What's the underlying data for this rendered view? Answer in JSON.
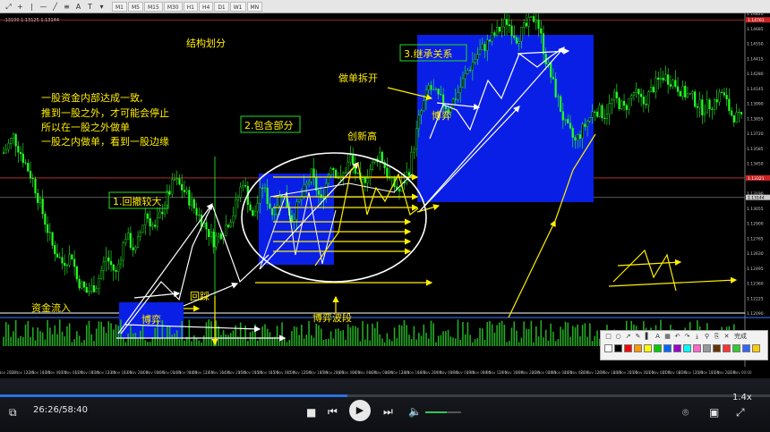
{
  "toolbar": {
    "timeframes": [
      "M1",
      "M5",
      "M15",
      "M30",
      "H1",
      "H4",
      "D1",
      "W1",
      "MN"
    ],
    "icons": [
      "cursor-icon",
      "crosshair-icon",
      "vertical-line-icon",
      "horizontal-line-icon",
      "trendline-icon",
      "pitchfork-icon",
      "text-icon",
      "label-icon",
      "dropdown-icon"
    ]
  },
  "colors": {
    "background": "#000000",
    "bull_candle": "#22ff22",
    "bear_candle": "#22ff22",
    "box_fill": "#0a1fe6",
    "white_arrow": "#ffffff",
    "yellow_arrow": "#ffee00",
    "annotation_text": "#ffee00",
    "box_label_border": "#22dd22",
    "level_line": "#cc3333",
    "volume_bar": "#22aa22"
  },
  "header": {
    "symbol_quote": ".13190 1.13125 1.13144"
  },
  "annotations": {
    "title_structure": "结构划分",
    "para_line1": "一股资金内部达成一致,",
    "para_line2": "推到一股之外，才可能会停止",
    "para_line3": "所以在一股之外做单",
    "para_line4": "一股之内做单，看到一股边缘",
    "label1": "1.回撤较大",
    "label2": "2.包含部分",
    "label3": "3.继承关系",
    "inflow": "资金流入",
    "game1": "博弈",
    "pullback": "回踩",
    "game_wave": "博弈波段",
    "new_high": "创新高",
    "split_order": "做单拆开",
    "game2": "博弈"
  },
  "chart_data": {
    "type": "candlestick",
    "symbol_quote": ".13190 1.13125 1.13144",
    "ylim": [
      1.1209,
      1.1482
    ],
    "y_ticks": [
      "1.14820",
      "1.14685",
      "1.14550",
      "1.14415",
      "1.14280",
      "1.14145",
      "1.13990",
      "1.13855",
      "1.13720",
      "1.13585",
      "1.13450",
      "1.13325",
      "1.13190",
      "1.13055",
      "1.12900",
      "1.12765",
      "1.12630",
      "1.12495",
      "1.12360",
      "1.12225",
      "1.12090"
    ],
    "highlighted_levels": [
      "1.14761",
      "1.13321",
      "1.13144"
    ],
    "x_ticks": [
      "9 Nov 2018",
      "12 Nov 12:00",
      "12 Nov 16:00",
      "13 Nov 00:00",
      "13 Nov 04:00",
      "13 Nov 08:00",
      "13 Nov 12:00",
      "13 Nov 16:00",
      "13 Nov 20:00",
      "14 Nov 00:00",
      "14 Nov 04:00",
      "14 Nov 08:00",
      "14 Nov 12:00",
      "14 Nov 16:00",
      "14 Nov 20:00",
      "15 Nov 00:00",
      "15 Nov 04:00",
      "15 Nov 08:00",
      "15 Nov 12:00",
      "15 Nov 16:00",
      "15 Nov 20:00",
      "16 Nov 00:00",
      "16 Nov 04:00",
      "16 Nov 08:00",
      "16 Nov 12:00",
      "16 Nov 16:00",
      "16 Nov 20:00",
      "19 Nov 00:00",
      "19 Nov 04:00",
      "19 Nov 08:00",
      "19 Nov 12:00",
      "19 Nov 16:00",
      "19 Nov 20:00",
      "20 Nov 00:00",
      "20 Nov 04:00",
      "20 Nov 08:00",
      "20 Nov 12:00",
      "20 Nov 16:00",
      "20 Nov 20:00",
      "21 Nov 00:00",
      "21 Nov 04:00",
      "21 Nov 08:00",
      "21 Nov 12:00",
      "21 Nov 16:00",
      "21 Nov 20:00",
      "22 Nov 00:00"
    ],
    "close_path": [
      [
        0,
        1.1355
      ],
      [
        4,
        1.137
      ],
      [
        8,
        1.135
      ],
      [
        12,
        1.133
      ],
      [
        16,
        1.13
      ],
      [
        20,
        1.127
      ],
      [
        24,
        1.1255
      ],
      [
        28,
        1.1262
      ],
      [
        30,
        1.124
      ],
      [
        34,
        1.1228
      ],
      [
        38,
        1.1235
      ],
      [
        42,
        1.126
      ],
      [
        46,
        1.1245
      ],
      [
        50,
        1.128
      ],
      [
        54,
        1.1265
      ],
      [
        58,
        1.13
      ],
      [
        62,
        1.1285
      ],
      [
        66,
        1.131
      ],
      [
        70,
        1.133
      ],
      [
        74,
        1.132
      ],
      [
        78,
        1.1305
      ],
      [
        82,
        1.129
      ],
      [
        86,
        1.1275
      ],
      [
        90,
        1.1285
      ],
      [
        94,
        1.13
      ],
      [
        98,
        1.133
      ],
      [
        102,
        1.1295
      ],
      [
        106,
        1.1325
      ],
      [
        110,
        1.13
      ],
      [
        114,
        1.132
      ],
      [
        118,
        1.1295
      ],
      [
        122,
        1.1315
      ],
      [
        126,
        1.1335
      ],
      [
        130,
        1.131
      ],
      [
        134,
        1.1345
      ],
      [
        138,
        1.133
      ],
      [
        142,
        1.135
      ],
      [
        146,
        1.1325
      ],
      [
        150,
        1.134
      ],
      [
        154,
        1.1355
      ],
      [
        158,
        1.133
      ],
      [
        162,
        1.132
      ],
      [
        166,
        1.134
      ],
      [
        170,
        1.1385
      ],
      [
        174,
        1.1415
      ],
      [
        178,
        1.1405
      ],
      [
        182,
        1.1395
      ],
      [
        186,
        1.141
      ],
      [
        190,
        1.143
      ],
      [
        194,
        1.1445
      ],
      [
        198,
        1.1455
      ],
      [
        202,
        1.1465
      ],
      [
        206,
        1.1475
      ],
      [
        210,
        1.146
      ],
      [
        214,
        1.147
      ],
      [
        218,
        1.148
      ],
      [
        222,
        1.144
      ],
      [
        226,
        1.141
      ],
      [
        230,
        1.138
      ],
      [
        234,
        1.1365
      ],
      [
        238,
        1.138
      ],
      [
        242,
        1.1395
      ],
      [
        246,
        1.139
      ],
      [
        250,
        1.1405
      ],
      [
        254,
        1.1395
      ],
      [
        258,
        1.141
      ],
      [
        262,
        1.14
      ],
      [
        266,
        1.1415
      ],
      [
        270,
        1.1425
      ],
      [
        274,
        1.142
      ],
      [
        278,
        1.141
      ],
      [
        282,
        1.1405
      ],
      [
        286,
        1.1395
      ],
      [
        290,
        1.14
      ],
      [
        294,
        1.141
      ],
      [
        298,
        1.139
      ],
      [
        302,
        1.1385
      ]
    ]
  },
  "player": {
    "time": "26:26/58:40",
    "progress": 0.4506,
    "volume": 0.6,
    "speed": "1.4x",
    "controls": [
      "subtitle-icon",
      "stop-icon",
      "prev-icon",
      "play-icon",
      "next-icon",
      "volume-icon",
      "camera-icon",
      "fullscreen-icon"
    ]
  },
  "annotation_toolbar": {
    "done_label": "完成",
    "swatch_colors": [
      "#ffffff",
      "#000000",
      "#ff0000",
      "#ff9900",
      "#ffff00",
      "#00cc00",
      "#0066ff",
      "#9900cc",
      "#00ffff",
      "#ff66cc",
      "#999999",
      "#663300",
      "#ff3333",
      "#33cc33",
      "#3366ff",
      "#ffcc00"
    ],
    "tool_icons": [
      "rect-icon",
      "ellipse-icon",
      "arrow-icon",
      "pen-icon",
      "marker-icon",
      "text-icon",
      "mosaic-icon",
      "undo-icon",
      "redo-icon",
      "save-icon",
      "pin-icon",
      "copy-icon",
      "close-icon"
    ]
  }
}
